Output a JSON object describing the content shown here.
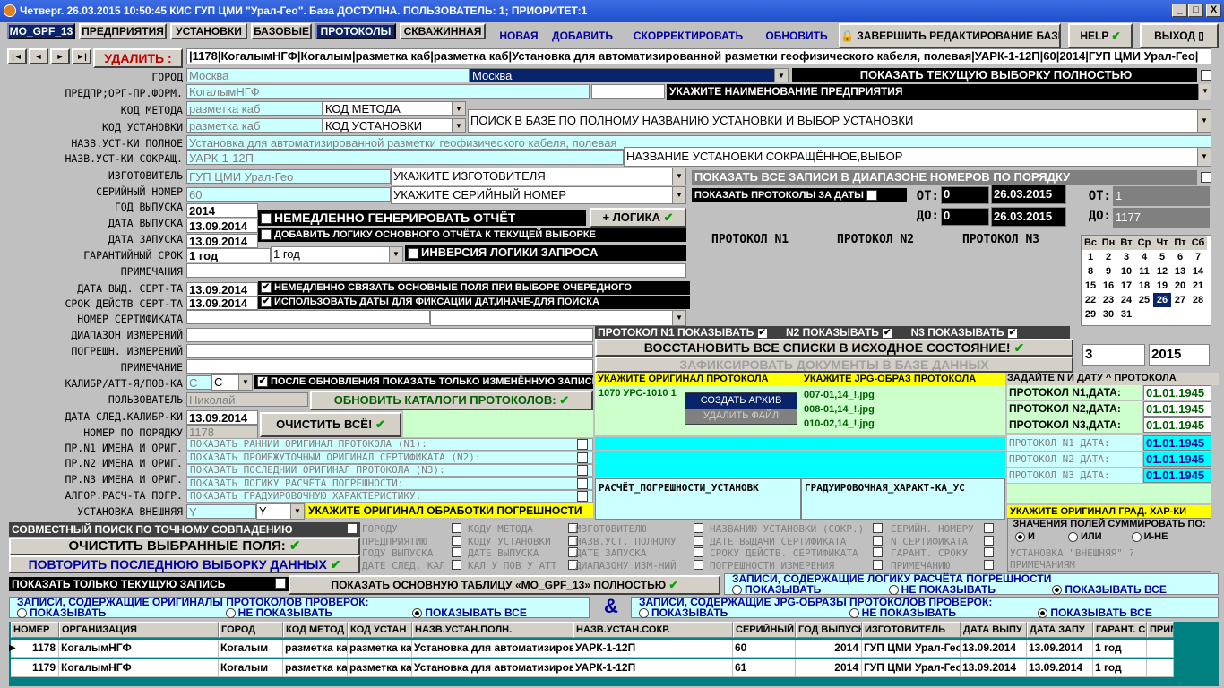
{
  "window": {
    "title": "Четверг. 26.03.2015 10:50:45 КИС ГУП ЦМИ \"Урал-Гео\". База ДОСТУПНА. ПОЛЬЗОВАТЕЛЬ: 1; ПРИОРИТЕТ:1",
    "minimize": "_",
    "maximize": "□",
    "close": "X"
  },
  "tabs": [
    "MO_GPF_13",
    "ПРЕДПРИЯТИЯ",
    "УСТАНОВКИ",
    "БАЗОВЫЕ",
    "ПРОТОКОЛЫ",
    "СКВАЖИННАЯ"
  ],
  "toolbar": {
    "new": "НОВАЯ",
    "add": "ДОБАВИТЬ",
    "edit": "СКОРРЕКТИРОВАТЬ",
    "refresh": "ОБНОВИТЬ",
    "finish": "ЗАВЕРШИТЬ РЕДАКТИРОВАНИЕ БАЗЫ",
    "help": "HELP",
    "exit": "ВЫХОД"
  },
  "nav": {
    "first": "|◄",
    "prev": "◄",
    "next": "►",
    "last": "►|",
    "delete": "УДАЛИТЬ :",
    "record": "|1178|КогалымНГФ|Когалым|разметка каб|разметка каб|Установка для автоматизированной разметки геофизического кабеля, полевая|УАРК-1-12П|60|2014|ГУП ЦМИ Урал-Гео|"
  },
  "labels": [
    "ГОРОД",
    "ПРЕДПР;ОРГ-ПР.ФОРМ.",
    "КОД МЕТОДА",
    "КОД УСТАНОВКИ",
    "НАЗВ.УСТ-КИ ПОЛНОЕ",
    "НАЗВ.УСТ-КИ СОКРАЩ.",
    "ИЗГОТОВИТЕЛЬ",
    "СЕРИЙНЫЙ НОМЕР",
    "ГОД ВЫПУСКА",
    "ДАТА ВЫПУСКА",
    "ДАТА ЗАПУСКА",
    "ГАРАНТИЙНЫЙ СРОК",
    "ПРИМЕЧАНИЯ",
    "ДАТА ВЫД. СЕРТ-ТА",
    "СРОК ДЕЙСТВ СЕРТ-ТА",
    "НОМЕР СЕРТИФИКАТА",
    "ДИАПАЗОН ИЗМЕРЕНИЙ",
    "ПОГРЕШН. ИЗМЕРЕНИЙ",
    "ПРИМЕЧАНИЕ",
    "КАЛИБР/АТТ-Я/ПОВ-КА",
    "ПОЛЬЗОВАТЕЛЬ",
    "ДАТА СЛЕД.КАЛИБР-КИ",
    "НОМЕР ПО ПОРЯДКУ",
    "ПР.N1 ИМЕНА И ОРИГ.",
    "ПР.N2 ИМЕНА И ОРИГ.",
    "ПР.N3 ИМЕНА И ОРИГ.",
    "АЛГОР.РАСЧ-ТА ПОГР.",
    "УСТАНОВКА ВНЕШНЯЯ"
  ],
  "fields": {
    "city": "Москва",
    "city_combo": "Москва",
    "org": "КогалымНГФ",
    "method": "разметка каб",
    "method_combo": "КОД МЕТОДА",
    "install": "разметка каб",
    "install_combo": "КОД УСТАНОВКИ",
    "name_full": "Установка для автоматизированной разметки геофизического кабеля, полевая",
    "name_short": "УАРК-1-12П",
    "maker": "ГУП ЦМИ Урал-Гео",
    "serial": "60",
    "year": "2014",
    "release": "13.09.2014",
    "start": "13.09.2014",
    "warranty": "1 год",
    "warranty_combo": "1 год",
    "cert_date": "13.09.2014",
    "cert_valid": "13.09.2014",
    "calib": "С",
    "calib_combo": "С",
    "user": "Николай",
    "next_calib": "13.09.2014",
    "order_no": "1178",
    "external": "Y",
    "external_combo": "Y"
  },
  "hints": {
    "show_current": "ПОКАЗАТЬ ТЕКУЩУЮ ВЫБОРКУ ПОЛНОСТЬЮ",
    "org_hint": "УКАЖИТЕ НАИМЕНОВАНИЕ ПРЕДПРИЯТИЯ",
    "install_search": "ПОИСК В БАЗЕ ПО ПОЛНОМУ НАЗВАНИЮ УСТАНОВКИ И ВЫБОР УСТАНОВКИ",
    "short_hint": "НАЗВАНИЕ УСТАНОВКИ СОКРАЩЁННОЕ,ВЫБОР",
    "maker_hint": "УКАЖИТЕ ИЗГОТОВИТЕЛЯ",
    "serial_hint": "УКАЖИТЕ СЕРИЙНЫЙ НОМЕР",
    "gen_report": "НЕМЕДЛЕННО ГЕНЕРИРОВАТЬ ОТЧЁТ",
    "logic": "+ ЛОГИКА",
    "add_logic": "ДОБАВИТЬ ЛОГИКУ ОСНОВНОГО ОТЧЁТА К ТЕКУЩЕЙ ВЫБОРКЕ",
    "invert": "ИНВЕРСИЯ ЛОГИКИ ЗАПРОСА",
    "link_fields": "НЕМЕДЛЕННО СВЯЗАТЬ ОСНОВНЫЕ ПОЛЯ ПРИ ВЫБОРЕ ОЧЕРЕДНОГО",
    "use_dates": "ИСПОЛЬЗОВАТЬ ДАТЫ ДЛЯ ФИКСАЦИИ ДАТ,ИНАЧЕ-ДЛЯ ПОИСКА",
    "after_update": "ПОСЛЕ ОБНОВЛЕНИЯ ПОКАЗАТЬ ТОЛЬКО ИЗМЕНЁННУЮ ЗАПИСЬ",
    "update_catalogs": "ОБНОВИТЬ КАТАЛОГИ ПРОТОКОЛОВ:",
    "clear_all": "ОЧИСТИТЬ ВСЁ!"
  },
  "range": {
    "show_all": "ПОКАЗАТЬ ВСЕ ЗАПИСИ В ДИАПАЗОНЕ НОМЕРОВ ПО ПОРЯДКУ",
    "show_dates": "ПОКАЗАТЬ ПРОТОКОЛЫ ЗА ДАТЫ",
    "from": "ОТ:",
    "to": "ДО:",
    "from_n": "0",
    "to_n": "0",
    "from_date": "26.03.2015",
    "to_date": "26.03.2015",
    "from2": "ОТ:",
    "to2": "ДО:",
    "from2_v": "1",
    "to2_v": "1177"
  },
  "protocols": {
    "p1": "ПРОТОКОЛ  N1",
    "p2": "ПРОТОКОЛ  N2",
    "p3": "ПРОТОКОЛ  N3",
    "show1": "ПРОТОКОЛ  N1  ПОКАЗЫВАТЬ",
    "show2": "N2 ПОКАЗЫВАТЬ",
    "show3": "N3  ПОКАЗЫВАТЬ",
    "restore": "ВОССТАНОВИТЬ ВСЕ СПИСКИ В ИСХОДНОЕ СОСТОЯНИЕ!",
    "fix": "ЗАФИКСИРОВАТЬ ДОКУМЕНТЫ В БАЗЕ ДАННЫХ"
  },
  "calendar": {
    "days": [
      "Вс",
      "Пн",
      "Вт",
      "Ср",
      "Чт",
      "Пт",
      "Сб"
    ],
    "rows": [
      [
        "",
        "",
        "",
        "",
        "",
        "",
        "1"
      ],
      [
        "1",
        "2",
        "3",
        "4",
        "5",
        "6",
        "7"
      ],
      [
        "8",
        "9",
        "10",
        "11",
        "12",
        "13",
        "14"
      ],
      [
        "15",
        "16",
        "17",
        "18",
        "19",
        "20",
        "21"
      ],
      [
        "22",
        "23",
        "24",
        "25",
        "26",
        "27",
        "28"
      ],
      [
        "29",
        "30",
        "31",
        "",
        "",
        "",
        ""
      ]
    ],
    "selected": "26",
    "month": "3",
    "year": "2015"
  },
  "orig": {
    "header": "УКАЖИТЕ ОРИГИНАЛ ПРОТОКОЛА",
    "item": "1070 УРС-1010 1",
    "menu_create": "СОЗДАТЬ АРХИВ",
    "menu_delete": "УДАЛИТЬ ФАЙЛ",
    "calc": "РАСЧЁТ_ПОГРЕШНОСТИ_УСТАНОВК"
  },
  "jpg": {
    "header": "УКАЖИТЕ JPG-ОБРАЗ ПРОТОКОЛА",
    "items": [
      "007-01,14_!.jpg",
      "008-01,14_!.jpg",
      "010-02,14_!.jpg"
    ],
    "grad": "ГРАДУИРОВОЧНАЯ_ХАРАКТ-КА_УС"
  },
  "dates": {
    "header": "ЗАДАЙТЕ N И ДАТУ ^ ПРОТОКОЛА",
    "rows": [
      {
        "label": "ПРОТОКОЛ N1,ДАТА:",
        "value": "01.01.1945"
      },
      {
        "label": "ПРОТОКОЛ N2,ДАТА:",
        "value": "01.01.1945"
      },
      {
        "label": "ПРОТОКОЛ N3,ДАТА:",
        "value": "01.01.1945"
      }
    ],
    "rows2": [
      {
        "label": "ПРОТОКОЛ N1 ДАТА:",
        "value": "01.01.1945"
      },
      {
        "label": "ПРОТОКОЛ N2 ДАТА:",
        "value": "01.01.1945"
      },
      {
        "label": "ПРОТОКОЛ N3 ДАТА:",
        "value": "01.01.1945"
      }
    ],
    "grad_hint": "УКАЖИТЕ ОРИГИНАЛ ГРАД. ХАР-КИ"
  },
  "showlist": [
    "ПОКАЗАТЬ РАННИЙ ОРИГИНАЛ ПРОТОКОЛА (N1):",
    "ПОКАЗАТЬ ПРОМЕЖУТОЧНЫЙ ОРИГИНАЛ СЕРТИФИКАТА (N2):",
    "ПОКАЗАТЬ ПОСЛЕДНИЙ ОРИГИНАЛ ПРОТОКОЛА (N3):",
    "ПОКАЗАТЬ ЛОГИКУ РАСЧЁТА ПОГРЕШНОСТИ:",
    "ПОКАЗАТЬ ГРАДУИРОВОЧНУЮ ХАРАКТЕРИСТИКУ:"
  ],
  "err_hint": "УКАЖИТЕ ОРИГИНАЛ ОБРАБОТКИ ПОГРЕШНОСТИ",
  "bottom": {
    "exact": "СОВМЕСТНЫЙ ПОИСК ПО ТОЧНОМУ СОВПАДЕНИЮ",
    "clear_sel": "ОЧИСТИТЬ ВЫБРАННЫЕ ПОЛЯ:",
    "repeat": "ПОВТОРИТЬ ПОСЛЕДНЮЮ ВЫБОРКУ ДАННЫХ",
    "only_current": "ПОКАЗАТЬ ТОЛЬКО ТЕКУЩУЮ ЗАПИСЬ",
    "show_main": "ПОКАЗАТЬ ОСНОВНУЮ ТАБЛИЦУ «MO_GPF_13» ПОЛНОСТЬЮ"
  },
  "filters": [
    [
      "ГОРОДУ",
      "КОДУ МЕТОДА",
      "ИЗГОТОВИТЕЛЮ",
      "НАЗВАНИЮ УСТАНОВКИ (СОКР.)",
      "СЕРИЙН. НОМЕРУ"
    ],
    [
      "ПРЕДПРИЯТИЮ",
      "КОДУ УСТАНОВКИ",
      "НАЗВ.УСТ. ПОЛНОМУ",
      "ДАТЕ ВЫДАЧИ СЕРТИФИКАТА",
      "N СЕРТИФИКАТА"
    ],
    [
      "ГОДУ ВЫПУСКА",
      "ДАТЕ ВЫПУСКА",
      "ДАТЕ ЗАПУСКА",
      "СРОКУ ДЕЙСТВ. СЕРТИФИКАТА",
      "ГАРАНТ. СРОКУ"
    ],
    [
      "ДАТЕ СЛЕД. КАЛ",
      "КАЛ У ПОВ У АТТ",
      "ДИАПАЗОНУ ИЗМ-НИЙ",
      "ПОГРЕШНОСТИ ИЗМЕРЕНИЯ",
      "ПРИМЕЧАНИЮ"
    ]
  ],
  "sum": {
    "title": "ЗНАЧЕНИЯ ПОЛЕЙ СУММИРОВАТЬ ПО:",
    "and": "И",
    "or": "ИЛИ",
    "nor": "И-НЕ",
    "ext": "УСТАНОВКА \"ВНЕШНЯЯ\" ?",
    "note": "ПРИМЕЧАНИЯМ"
  },
  "logic_grp": {
    "title": "ЗАПИСИ, СОДЕРЖАЩИЕ ЛОГИКУ РАСЧЁТА ПОГРЕШНОСТИ",
    "show": "ПОКАЗЫВАТЬ",
    "noshow": "НЕ ПОКАЗЫВАТЬ",
    "all": "ПОКАЗЫВАТЬ ВСЕ"
  },
  "orig_grp": {
    "title": "ЗАПИСИ, СОДЕРЖАЩИЕ ОРИГИНАЛЫ ПРОТОКОЛОВ ПРОВЕРОК:",
    "show": "ПОКАЗЫВАТЬ",
    "noshow": "НЕ ПОКАЗЫВАТЬ",
    "all": "ПОКАЗЫВАТЬ ВСЕ"
  },
  "amp": "&",
  "jpg_grp": {
    "title": "ЗАПИСИ, СОДЕРЖАЩИЕ JPG-ОБРАЗЫ ПРОТОКОЛОВ ПРОВЕРОК:",
    "show": "ПОКАЗЫВАТЬ",
    "noshow": "НЕ ПОКАЗЫВАТЬ",
    "all": "ПОКАЗЫВАТЬ ВСЕ"
  },
  "grid": {
    "columns": [
      "НОМЕР",
      "ОРГАНИЗАЦИЯ",
      "ГОРОД",
      "КОД МЕТОД",
      "КОД УСТАН",
      "НАЗВ.УСТАН.ПОЛН.",
      "НАЗВ.УСТАН.СОКР.",
      "СЕРИЙНЫЙ",
      "ГОД ВЫПУСК",
      "ИЗГОТОВИТЕЛЬ",
      "ДАТА ВЫПУ",
      "ДАТА ЗАПУ",
      "ГАРАНТ. СР",
      "ПРИМ"
    ],
    "rows": [
      [
        "1178",
        "КогалымНГФ",
        "Когалым",
        "разметка ка",
        "разметка ка",
        "Установка для автоматизиров",
        "УАРК-1-12П",
        "60",
        "2014",
        "ГУП ЦМИ Урал-Гео",
        "13.09.2014",
        "13.09.2014",
        "1 год",
        ""
      ],
      [
        "1179",
        "КогалымНГФ",
        "Когалым",
        "разметка ка",
        "разметка ка",
        "Установка для автоматизиров",
        "УАРК-1-12П",
        "61",
        "2014",
        "ГУП ЦМИ Урал-Гео",
        "13.09.2014",
        "13.09.2014",
        "1 год",
        ""
      ]
    ]
  }
}
